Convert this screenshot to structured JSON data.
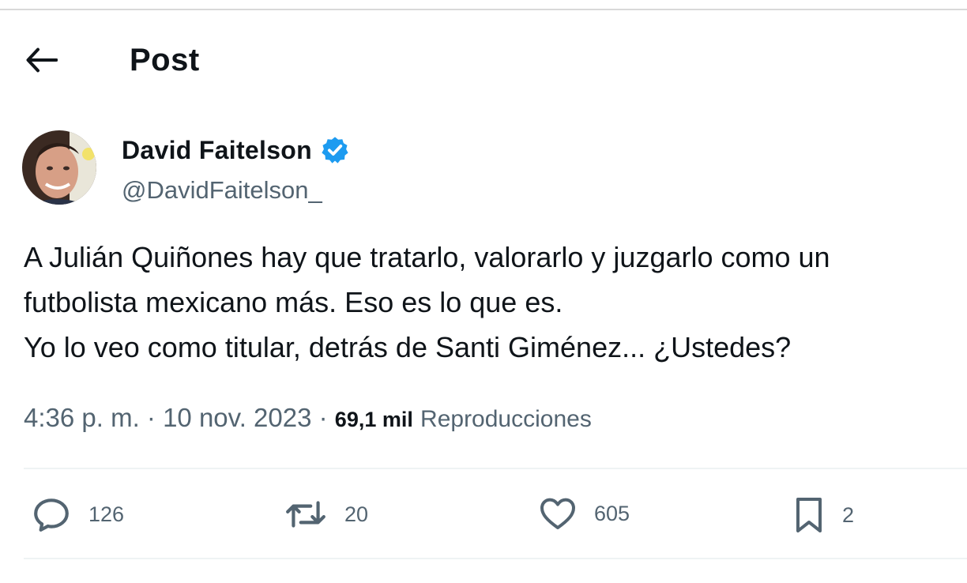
{
  "header": {
    "title": "Post",
    "back_icon": "arrow-left-icon"
  },
  "author": {
    "display_name": "David Faitelson",
    "handle": "@DavidFaitelson_",
    "verified_icon": "verified-badge-icon",
    "verified_color": "#1d9bf0"
  },
  "tweet": {
    "lines": [
      "A Julián Quiñones hay que tratarlo, valorarlo y juzgarlo como un",
      "futbolista mexicano más. Eso es lo que es.",
      "Yo lo veo como titular, detrás de Santi Giménez... ¿Ustedes?"
    ]
  },
  "meta": {
    "time": "4:36 p. m.",
    "separator": " · ",
    "date": "10 nov. 2023",
    "views_count": "69,1 mil",
    "views_label": "Reproducciones"
  },
  "actions": {
    "replies": {
      "icon": "reply-icon",
      "count": "126"
    },
    "reposts": {
      "icon": "repost-icon",
      "count": "20"
    },
    "likes": {
      "icon": "heart-icon",
      "count": "605"
    },
    "bookmarks": {
      "icon": "bookmark-icon",
      "count": "2"
    }
  },
  "colors": {
    "text_primary": "#0f1419",
    "text_secondary": "#536471",
    "divider": "#eff3f4"
  }
}
